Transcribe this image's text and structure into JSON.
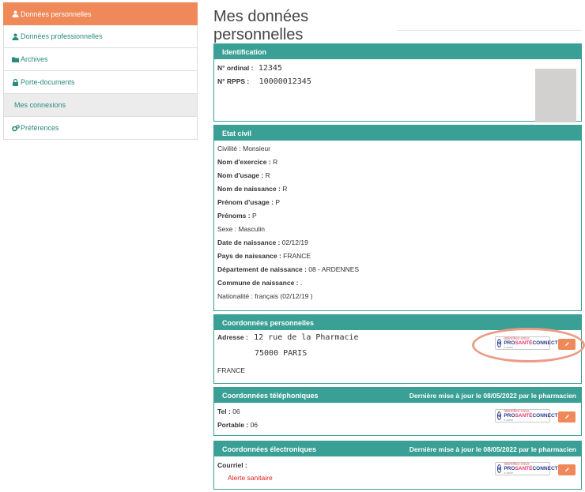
{
  "sidebar": {
    "items": [
      {
        "label": "Données personnelles",
        "icon": "user-icon"
      },
      {
        "label": "Données professionnelles",
        "icon": "user-icon"
      },
      {
        "label": "Archives",
        "icon": "folder-icon"
      },
      {
        "label": "Porte-documents",
        "icon": "lock-icon"
      },
      {
        "label": "Mes connexions",
        "icon": ""
      },
      {
        "label": "Préférences",
        "icon": "gears-icon"
      }
    ]
  },
  "page": {
    "title": "Mes données personnelles"
  },
  "identification": {
    "header": "Identification",
    "ordinal_label": "N° ordinal :",
    "ordinal_value": "12345",
    "rpps_label": "N° RPPS :",
    "rpps_value": "10000012345"
  },
  "etat_civil": {
    "header": "Etat civil",
    "fields": [
      {
        "label": "Civilité :",
        "value": " Monsieur"
      },
      {
        "label": "Nom d'exercice :",
        "value": " R"
      },
      {
        "label": "Nom d'usage :",
        "value": " R"
      },
      {
        "label": "Nom de naissance :",
        "value": " R"
      },
      {
        "label": "Prénom d'usage :",
        "value": " P"
      },
      {
        "label": "Prénoms :",
        "value": " P"
      },
      {
        "label": "Sexe :",
        "value": " Masculin"
      },
      {
        "label": "Date de naissance :",
        "value": " 02/12/19"
      },
      {
        "label": "Pays de naissance :",
        "value": " FRANCE"
      },
      {
        "label": "Département de naissance :",
        "value": " 08 - ARDENNES"
      },
      {
        "label": "Commune de naissance :",
        "value": " ."
      },
      {
        "label": "Nationalité :",
        "value": " français (02/12/19     )"
      }
    ]
  },
  "coord_perso": {
    "header": "Coordonnées personnelles",
    "address_label": "Adresse :",
    "address_line1": "12 rue de la Pharmacie",
    "address_line2": "75000 PARIS",
    "country": "FRANCE"
  },
  "coord_tel": {
    "header": "Coordonnées téléphoniques",
    "update": "Dernière mise à jour le 08/05/2022 par le pharmacien",
    "tel_label": "Tel :",
    "tel_value": " 06",
    "mobile_label": "Portable :",
    "mobile_value": " 06"
  },
  "coord_elec": {
    "header": "Coordonnées électroniques",
    "update": "Dernière mise à jour le 08/05/2022 par le pharmacien",
    "email_label": "Courriel :",
    "alert": "Alerte sanitaire"
  },
  "psc_badge": {
    "letter": "e",
    "top": "Identifiez-vous",
    "pro": "PRO",
    "sante": "SANTÉ",
    "connect": "CONNECT",
    "bottom": "e-santé"
  },
  "colors": {
    "accent": "#3a9f94",
    "active": "#f0895a",
    "highlight": "#ec9c85"
  }
}
